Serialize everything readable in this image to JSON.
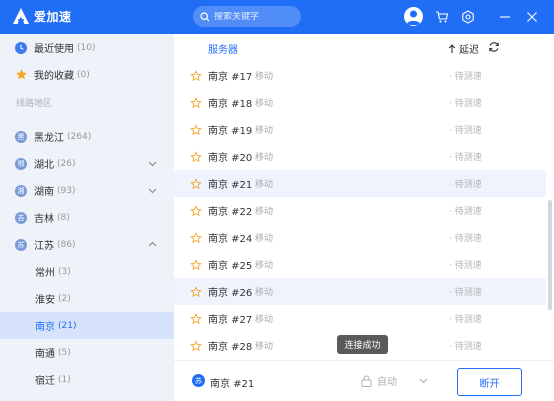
{
  "app": {
    "name": "爱加速"
  },
  "search": {
    "placeholder": "搜索关键字"
  },
  "sidebar": {
    "top_items": [
      {
        "label": "最近使用",
        "count": "(10)",
        "icon": "clock-icon"
      },
      {
        "label": "我的收藏",
        "count": "(0)",
        "icon": "star-icon"
      }
    ],
    "section_header": "线路地区",
    "regions": [
      {
        "badge": "黑",
        "label": "黑龙江",
        "count": "(264)"
      },
      {
        "badge": "鄂",
        "label": "湖北",
        "count": "(26)"
      },
      {
        "badge": "湘",
        "label": "湖南",
        "count": "(93)"
      },
      {
        "badge": "吉",
        "label": "吉林",
        "count": "(8)"
      },
      {
        "badge": "苏",
        "label": "江苏",
        "count": "(86)"
      }
    ],
    "cities": [
      {
        "label": "常州",
        "count": "(3)"
      },
      {
        "label": "淮安",
        "count": "(2)"
      },
      {
        "label": "南京",
        "count": "(21)"
      },
      {
        "label": "南通",
        "count": "(5)"
      },
      {
        "label": "宿迁",
        "count": "(1)"
      }
    ],
    "selected_city": "南京"
  },
  "table": {
    "header_server": "服务器",
    "header_latency": "延迟",
    "rows": [
      {
        "name": "南京 #17",
        "type": "移动",
        "status": "待测速"
      },
      {
        "name": "南京 #18",
        "type": "移动",
        "status": "待测速"
      },
      {
        "name": "南京 #19",
        "type": "移动",
        "status": "待测速"
      },
      {
        "name": "南京 #20",
        "type": "移动",
        "status": "待测速"
      },
      {
        "name": "南京 #21",
        "type": "移动",
        "status": "待测速"
      },
      {
        "name": "南京 #22",
        "type": "移动",
        "status": "待测速"
      },
      {
        "name": "南京 #24",
        "type": "移动",
        "status": "待测速"
      },
      {
        "name": "南京 #25",
        "type": "移动",
        "status": "待测速"
      },
      {
        "name": "南京 #26",
        "type": "移动",
        "status": "待测速"
      },
      {
        "name": "南京 #27",
        "type": "移动",
        "status": "待测速"
      },
      {
        "name": "南京 #28",
        "type": "移动",
        "status": "待测速"
      }
    ]
  },
  "toast": "连接成功",
  "bottom": {
    "badge": "苏",
    "current_server": "南京 #21",
    "mode": "自动",
    "disconnect_label": "断开"
  },
  "colors": {
    "accent": "#1f6ef5",
    "sidebar_bg": "#eef2f9",
    "selected_bg": "#d6e3fa",
    "star": "#f5a623"
  }
}
